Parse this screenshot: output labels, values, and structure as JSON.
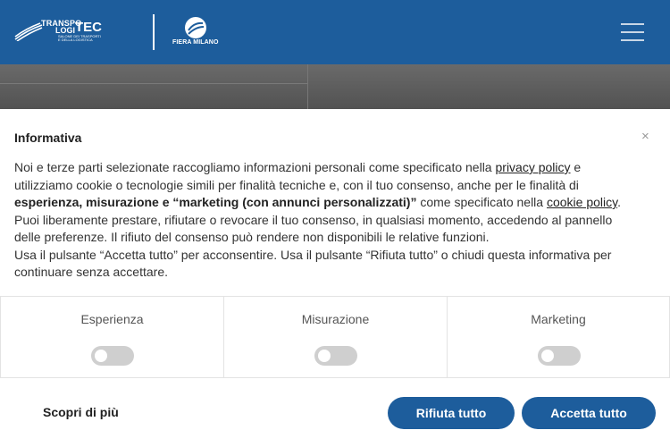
{
  "header": {
    "logo_left": {
      "line1": "TRANSPO",
      "line2": "LOGI",
      "tec": "TEC",
      "sub1": "SALONE DEI TRASPORTI",
      "sub2": "E DELLA LOGISTICA"
    },
    "logo_right": {
      "text": "FIERA MILANO"
    },
    "menu_icon": "hamburger-icon",
    "colors": {
      "brand": "#1d5d9c"
    }
  },
  "consent": {
    "title": "Informativa",
    "close_icon": "×",
    "paragraph": {
      "p1_a": "Noi e terze parti selezionate raccogliamo informazioni personali come specificato nella ",
      "p1_link": "privacy policy",
      "p1_b": " e utilizziamo cookie o tecnologie simili per finalità tecniche e, con il tuo consenso, anche per le finalità di ",
      "p1_bold": "esperienza, misurazione e “marketing (con annunci personalizzati)”",
      "p1_c": " come specificato nella ",
      "p1_link2": "cookie policy",
      "p1_d": ". Puoi liberamente prestare, rifiutare o revocare il tuo consenso, in qualsiasi momento, accedendo al pannello delle preferenze. Il rifiuto del consenso può rendere non disponibili le relative funzioni.",
      "p2": "Usa il pulsante “Accetta tutto” per acconsentire. Usa il pulsante “Rifiuta tutto” o chiudi questa informativa per continuare senza accettare."
    },
    "categories": [
      {
        "label": "Esperienza",
        "enabled": false
      },
      {
        "label": "Misurazione",
        "enabled": false
      },
      {
        "label": "Marketing",
        "enabled": false
      }
    ],
    "buttons": {
      "learn_more": "Scopri di più",
      "reject": "Rifiuta tutto",
      "accept": "Accetta tutto"
    }
  }
}
